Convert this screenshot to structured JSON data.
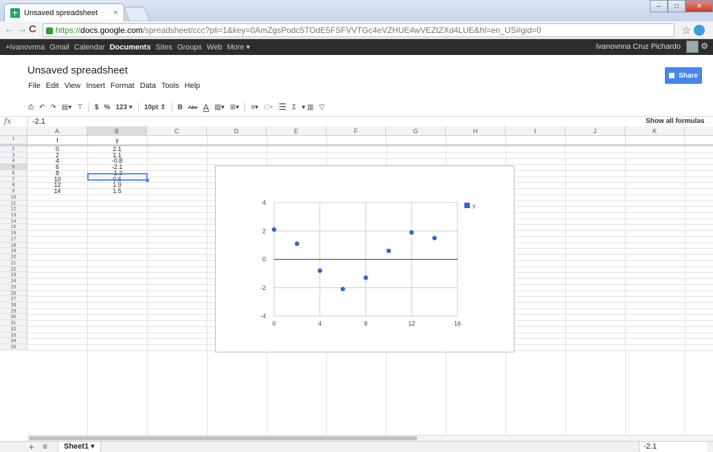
{
  "browser": {
    "tab_title": "Unsaved spreadsheet",
    "tab_close": "×",
    "url_scheme": "https://",
    "url_host": "docs.google.com",
    "url_path": "/spreadsheet/ccc?pli=1&key=0AmZgsPodc5TOdE5FSFVVTGc4eVZHUE4wVEZtZXd4LUE&hl=en_US#gid=0"
  },
  "gbar": {
    "items": [
      "+Ivanovnna",
      "Gmail",
      "Calendar",
      "Documents",
      "Sites",
      "Groups",
      "Web",
      "More ▾"
    ],
    "user": "Ivanovnna Cruz Pichardo"
  },
  "doc": {
    "title": "Unsaved spreadsheet",
    "menus": [
      "File",
      "Edit",
      "View",
      "Insert",
      "Format",
      "Data",
      "Tools",
      "Help"
    ],
    "share_label": "Share"
  },
  "toolbar": {
    "currency": "$",
    "percent": "%",
    "number_format": "123 ▾",
    "font_size": "10pt ⇕",
    "bold": "B",
    "strike": "Abc",
    "text_color": "A",
    "sum": "Σ"
  },
  "formula_bar": {
    "fx": "fx",
    "value": "-2.1",
    "show_formulas": "Show all formulas"
  },
  "grid": {
    "columns": [
      "A",
      "B",
      "C",
      "D",
      "E",
      "F",
      "G",
      "H",
      "I",
      "J",
      "K"
    ],
    "rows": [
      "1",
      "2",
      "3",
      "4",
      "5",
      "6",
      "7",
      "8",
      "9",
      "10",
      "11",
      "12",
      "13",
      "14",
      "15",
      "16",
      "17",
      "18",
      "19",
      "20",
      "21",
      "22",
      "23",
      "24",
      "25",
      "26",
      "27",
      "28",
      "29",
      "30",
      "31",
      "32",
      "33",
      "34",
      "35"
    ],
    "selected_column": "B",
    "selected_row": "5",
    "cells": [
      [
        "t",
        "y"
      ],
      [
        "0",
        "2.1"
      ],
      [
        "2",
        "1.1"
      ],
      [
        "4",
        "-0.8"
      ],
      [
        "6",
        "-2.1"
      ],
      [
        "8",
        "-1.3"
      ],
      [
        "10",
        "0.6"
      ],
      [
        "12",
        "1.9"
      ],
      [
        "14",
        "1.5"
      ]
    ]
  },
  "chart_data": {
    "type": "scatter",
    "series": [
      {
        "name": "y",
        "x": [
          0,
          2,
          4,
          6,
          8,
          10,
          12,
          14
        ],
        "y": [
          2.1,
          1.1,
          -0.8,
          -2.1,
          -1.3,
          0.6,
          1.9,
          1.5
        ]
      }
    ],
    "xlim": [
      0,
      16
    ],
    "ylim": [
      -4,
      4
    ],
    "x_ticks": [
      0,
      4,
      8,
      12,
      16
    ],
    "y_ticks": [
      4,
      2,
      0,
      -2,
      -4
    ],
    "legend": "right",
    "grid": true,
    "color": "#3366cc"
  },
  "sheets": {
    "add": "+",
    "list": "≡",
    "active_sheet": "Sheet1 ▾",
    "selection_value": "-2.1"
  }
}
